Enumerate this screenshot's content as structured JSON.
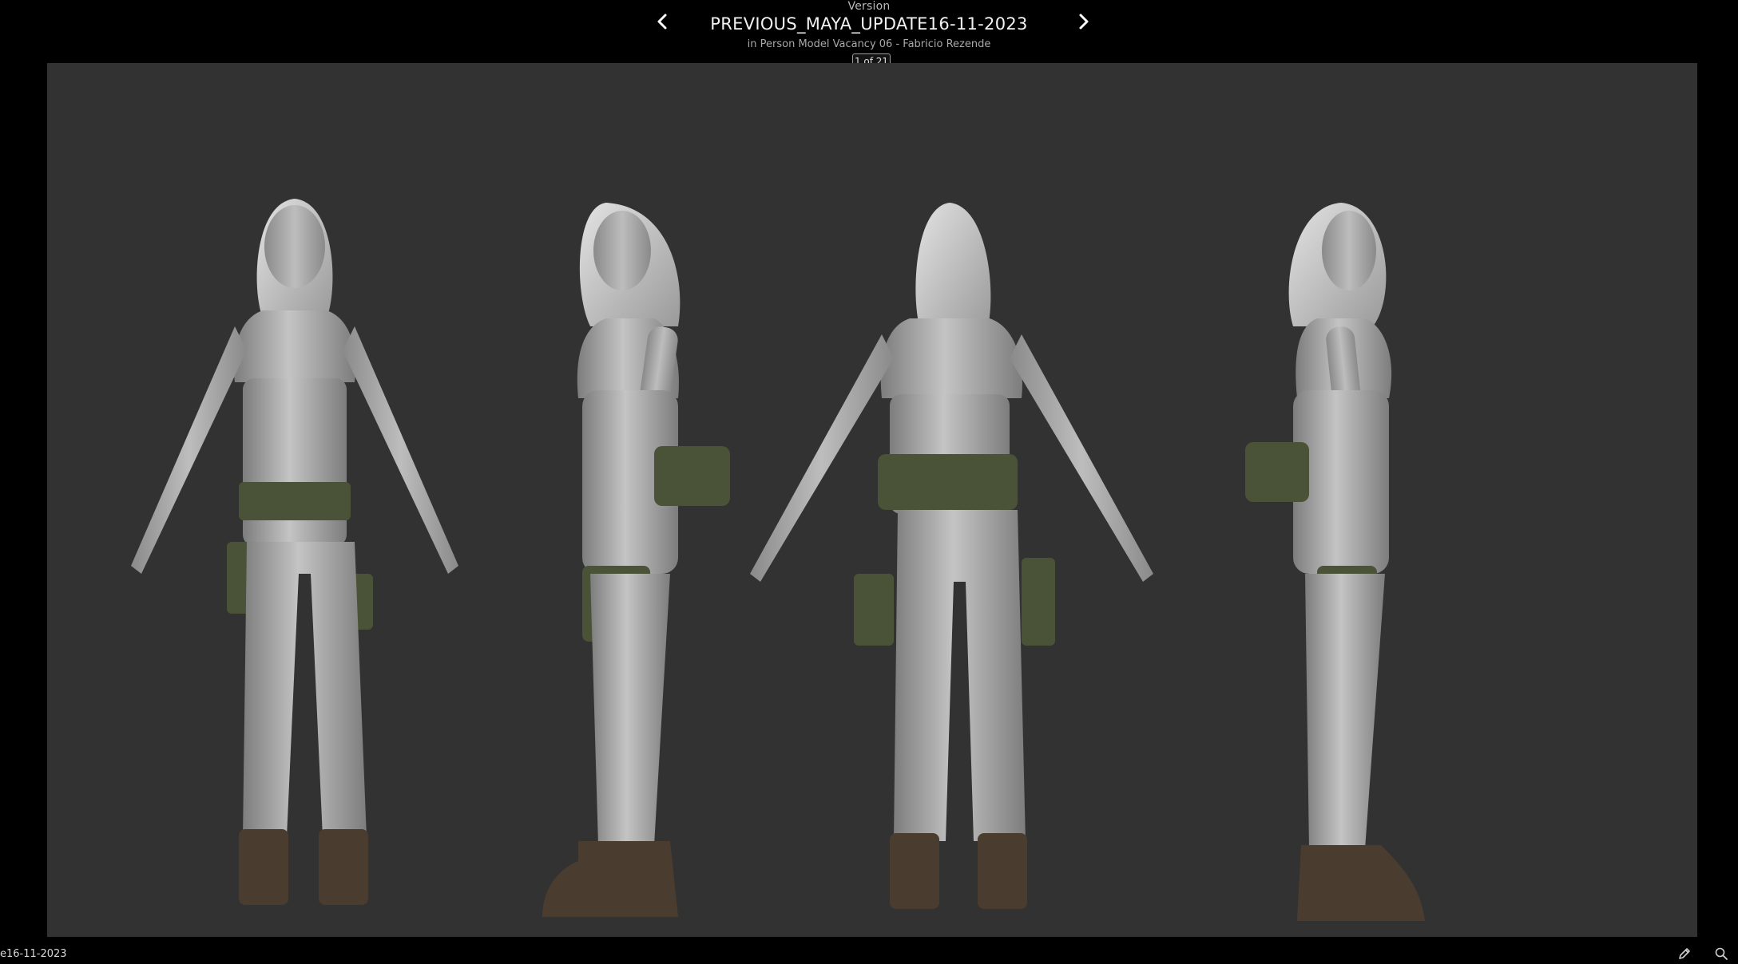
{
  "header": {
    "kicker": "Version",
    "title": "PREVIOUS_MAYA_UPDATE16-11-2023",
    "subtitle": "in Person Model Vacancy 06 - Fabricio Rezende",
    "counter": "1 of 21"
  },
  "footer": {
    "label": "e16-11-2023"
  },
  "icons": {
    "prev": "chevron-left-icon",
    "next": "chevron-right-icon",
    "pencil": "pencil-icon",
    "search": "search-icon"
  },
  "colors": {
    "background": "#000000",
    "stage": "#323232",
    "figure": "#a8a8a8",
    "gear": "#4a5238",
    "boots": "#4a3d30"
  }
}
